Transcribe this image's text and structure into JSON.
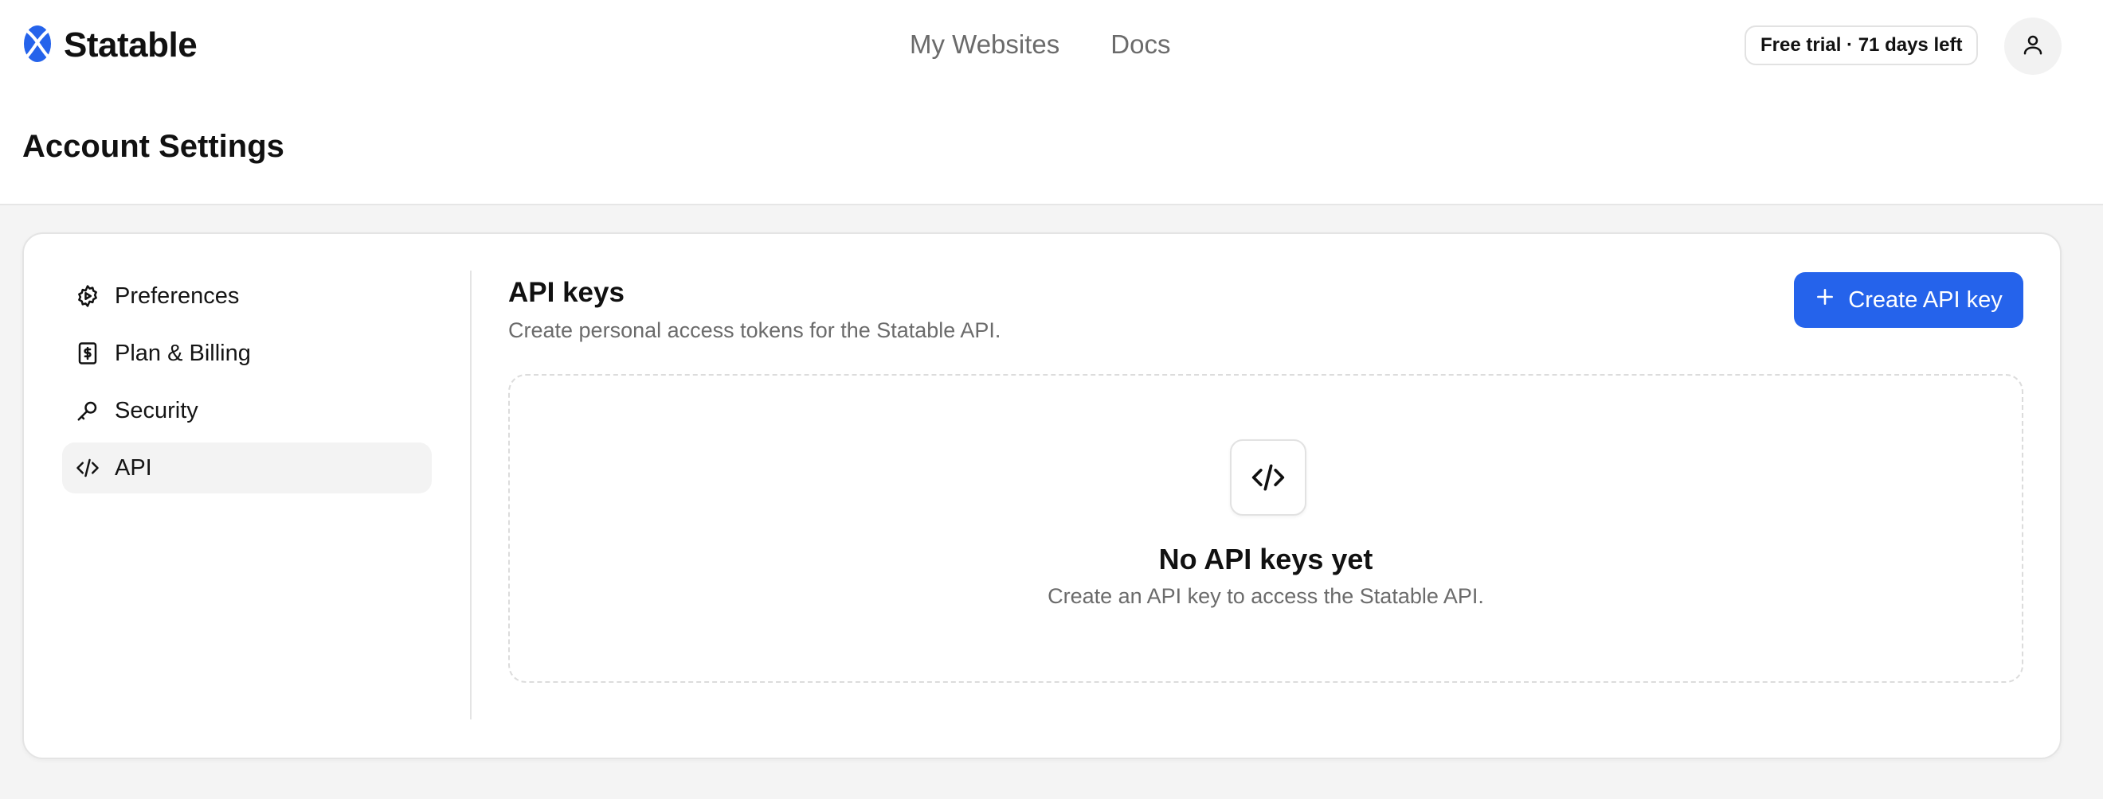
{
  "app": {
    "name": "Statable"
  },
  "nav": {
    "items": [
      {
        "label": "My Websites"
      },
      {
        "label": "Docs"
      }
    ]
  },
  "trial_badge": "Free trial · 71 days left",
  "page_title": "Account Settings",
  "sidebar": {
    "items": [
      {
        "label": "Preferences",
        "icon": "gear-icon",
        "active": false
      },
      {
        "label": "Plan & Billing",
        "icon": "dollar-receipt-icon",
        "active": false
      },
      {
        "label": "Security",
        "icon": "key-icon",
        "active": false
      },
      {
        "label": "API",
        "icon": "code-icon",
        "active": true
      }
    ]
  },
  "api_section": {
    "title": "API keys",
    "subtitle": "Create personal access tokens for the Statable API.",
    "create_button_label": "Create API key",
    "empty_state": {
      "icon": "code-icon",
      "title": "No API keys yet",
      "subtitle": "Create an API key to access the Statable API."
    }
  },
  "colors": {
    "accent": "#2563eb",
    "brand": "#1d4ed8"
  }
}
